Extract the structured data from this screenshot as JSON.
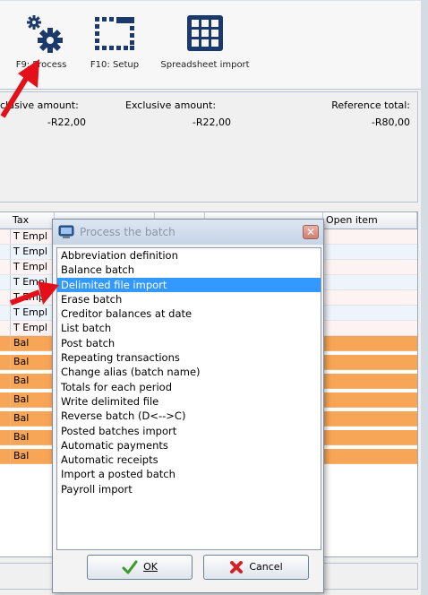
{
  "toolbar": {
    "process_label": "F9: Process",
    "setup_label": "F10: Setup",
    "import_label": "Spreadsheet import"
  },
  "summary": {
    "inclusive_caption": "clusive amount:",
    "inclusive_value": "-R22,00",
    "exclusive_caption": "Exclusive amount:",
    "exclusive_value": "-R22,00",
    "reference_caption": "Reference total:",
    "reference_value": "-R80,00"
  },
  "grid": {
    "col_tax": "Tax",
    "col_open": "Open item",
    "rows": [
      "T Empl",
      "T Empl",
      "T Empl",
      "T Empl",
      "T Empl",
      "T Empl",
      "T Empl",
      "Bal",
      "Bal",
      "Bal",
      "Bal",
      "Bal",
      "Bal",
      "Bal"
    ]
  },
  "dialog": {
    "title": "Process the batch",
    "close_glyph": "✕",
    "items": [
      "Abbreviation definition",
      "Balance batch",
      "Delimited file import",
      "Erase batch",
      "Creditor balances at date",
      "List batch",
      "Post batch",
      "Repeating transactions",
      "Change alias (batch name)",
      "Totals for each period",
      "Write delimited file",
      "Reverse batch (D<-->C)",
      "Posted batches import",
      "Automatic payments",
      "Automatic receipts",
      "Import a posted batch",
      "Payroll import"
    ],
    "selected_item": "Delimited file import",
    "ok_label": "OK",
    "cancel_label": "Cancel"
  },
  "colors": {
    "selection": "#3399ff",
    "highlight_rows": "#f7a556",
    "annotation_arrow": "#e3101a"
  },
  "icons": [
    "gears-icon",
    "setup-frame-icon",
    "grid-icon",
    "dialog-app-icon",
    "checkmark-icon",
    "cancel-x-icon"
  ]
}
